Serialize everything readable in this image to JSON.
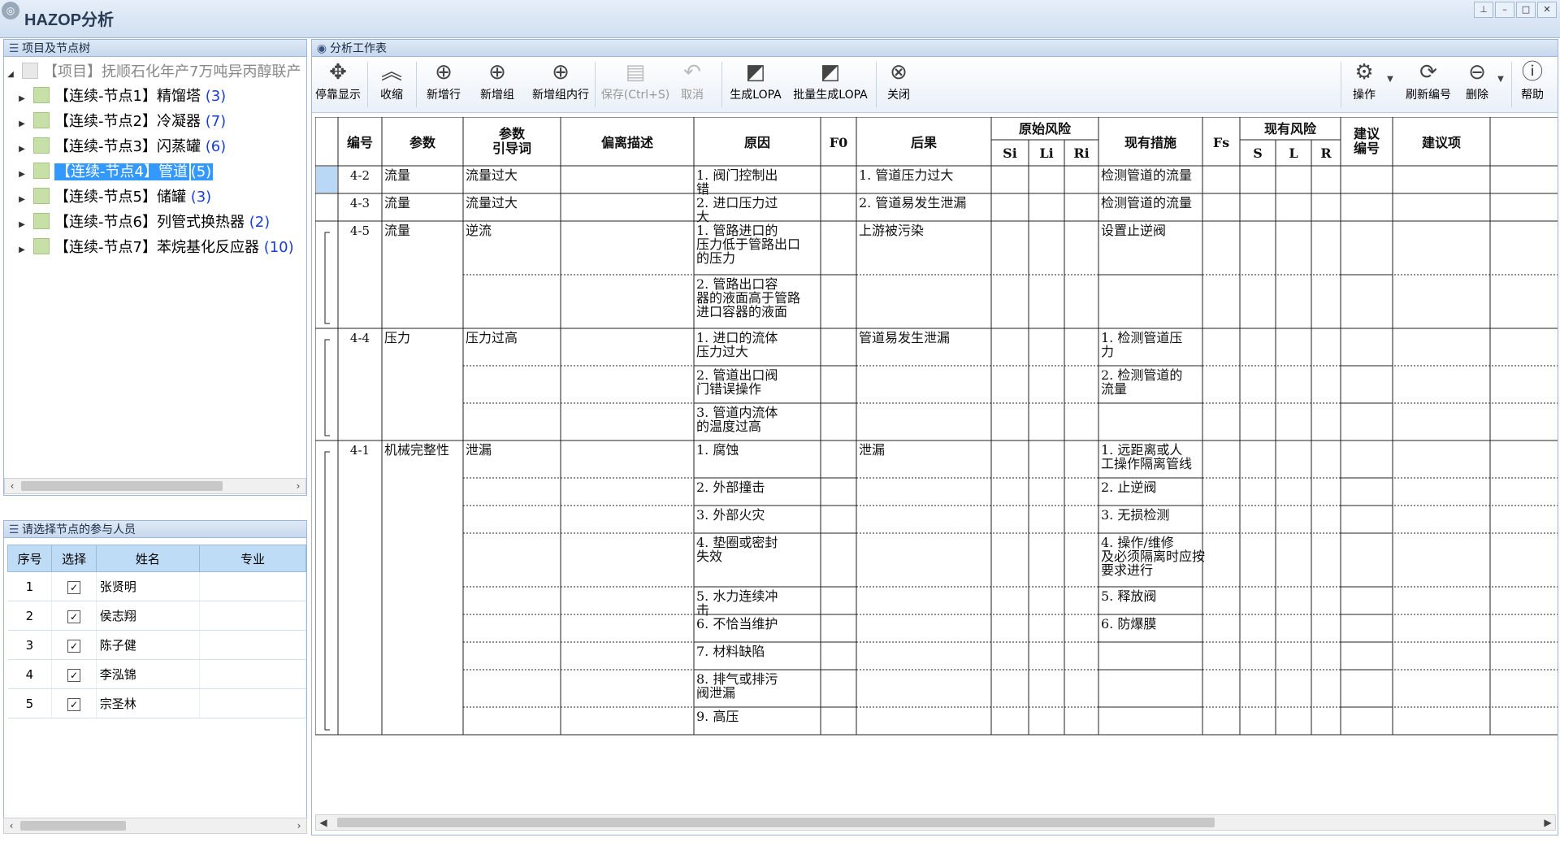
{
  "window": {
    "title": "HAZOP分析",
    "controls": [
      "pin-icon",
      "minimize-icon",
      "maximize-icon",
      "close-icon"
    ]
  },
  "tree_panel": {
    "header": "项目及节点树",
    "root": "【项目】抚顺石化年产7万吨异丙醇联产",
    "nodes": [
      {
        "label": "【连续-节点1】精馏塔",
        "count": "(3)"
      },
      {
        "label": "【连续-节点2】冷凝器",
        "count": "(7)"
      },
      {
        "label": "【连续-节点3】闪蒸罐",
        "count": "(6)"
      },
      {
        "label": "【连续-节点4】管道",
        "count": "(5)",
        "selected": true
      },
      {
        "label": "【连续-节点5】储罐",
        "count": "(3)"
      },
      {
        "label": "【连续-节点6】列管式换热器",
        "count": "(2)"
      },
      {
        "label": "【连续-节点7】苯烷基化反应器",
        "count": "(10)"
      }
    ]
  },
  "people_panel": {
    "header": "请选择节点的参与人员",
    "columns": [
      "序号",
      "选择",
      "姓名",
      "专业"
    ],
    "rows": [
      {
        "no": "1",
        "checked": true,
        "name": "张贤明",
        "major": ""
      },
      {
        "no": "2",
        "checked": true,
        "name": "侯志翔",
        "major": ""
      },
      {
        "no": "3",
        "checked": true,
        "name": "陈子健",
        "major": ""
      },
      {
        "no": "4",
        "checked": true,
        "name": "李泓锦",
        "major": ""
      },
      {
        "no": "5",
        "checked": true,
        "name": "宗圣林",
        "major": ""
      }
    ]
  },
  "worksheet": {
    "header": "分析工作表",
    "toolbar": {
      "dock": "停靠显示",
      "collapse": "收缩",
      "add_row": "新增行",
      "add_group": "新增组",
      "add_in_group": "新增组内行",
      "save": "保存(Ctrl+S)",
      "cancel": "取消",
      "gen_lopa": "生成LOPA",
      "batch_lopa": "批量生成LOPA",
      "close": "关闭",
      "operate": "操作",
      "renumber": "刷新编号",
      "delete": "删除",
      "help": "帮助"
    },
    "columns": {
      "no": "编号",
      "param": "参数",
      "guide_1": "参数",
      "guide_2": "引导词",
      "deviation": "偏离描述",
      "cause": "原因",
      "f0": "F0",
      "consequence": "后果",
      "orig_risk": "原始风险",
      "si": "Si",
      "li": "Li",
      "ri": "Ri",
      "measures": "现有措施",
      "fs": "Fs",
      "cur_risk": "现有风险",
      "s": "S",
      "l": "L",
      "r": "R",
      "sug_no_1": "建议",
      "sug_no_2": "编号",
      "suggestion": "建议项"
    },
    "groups": [
      {
        "no": "4-2",
        "param": "流量",
        "guide": "流量过大",
        "consequence": "1. 管道压力过大",
        "rows": [
          {
            "cause": "1. 阀门控制出错",
            "measure": "检测管道的流量"
          }
        ]
      },
      {
        "no": "4-3",
        "param": "流量",
        "guide": "流量过大",
        "consequence": "2. 管道易发生泄漏",
        "rows": [
          {
            "cause": "2. 进口压力过大",
            "measure": "检测管道的流量"
          }
        ]
      },
      {
        "no": "4-5",
        "param": "流量",
        "guide": "逆流",
        "consequence": "上游被污染",
        "rows": [
          {
            "cause": "1. 管路进口的压力低于管路出口的压力",
            "measure": "设置止逆阀"
          },
          {
            "cause": "2. 管路出口容器的液面高于管路进口容器的液面",
            "measure": ""
          }
        ]
      },
      {
        "no": "4-4",
        "param": "压力",
        "guide": "压力过高",
        "consequence": "管道易发生泄漏",
        "rows": [
          {
            "cause": "1. 进口的流体压力过大",
            "measure": "1. 检测管道压力"
          },
          {
            "cause": "2. 管道出口阀门错误操作",
            "measure": "2. 检测管道的流量"
          },
          {
            "cause": "3. 管道内流体的温度过高",
            "measure": ""
          }
        ]
      },
      {
        "no": "4-1",
        "param": "机械完整性",
        "guide": "泄漏",
        "consequence": "泄漏",
        "rows": [
          {
            "cause": "1. 腐蚀",
            "measure": "1. 远距离或人工操作隔离管线"
          },
          {
            "cause": "2. 外部撞击",
            "measure": "2. 止逆阀"
          },
          {
            "cause": "3. 外部火灾",
            "measure": "3. 无损检测"
          },
          {
            "cause": "4. 垫圈或密封失效",
            "measure": "4. 操作/维修及必须隔离时应按要求进行"
          },
          {
            "cause": "5. 水力连续冲击",
            "measure": "5. 释放阀"
          },
          {
            "cause": "6. 不恰当维护",
            "measure": "6. 防爆膜"
          },
          {
            "cause": "7. 材料缺陷",
            "measure": ""
          },
          {
            "cause": "8. 排气或排污阀泄漏",
            "measure": ""
          },
          {
            "cause": "9. 高压",
            "measure": ""
          }
        ]
      }
    ]
  }
}
